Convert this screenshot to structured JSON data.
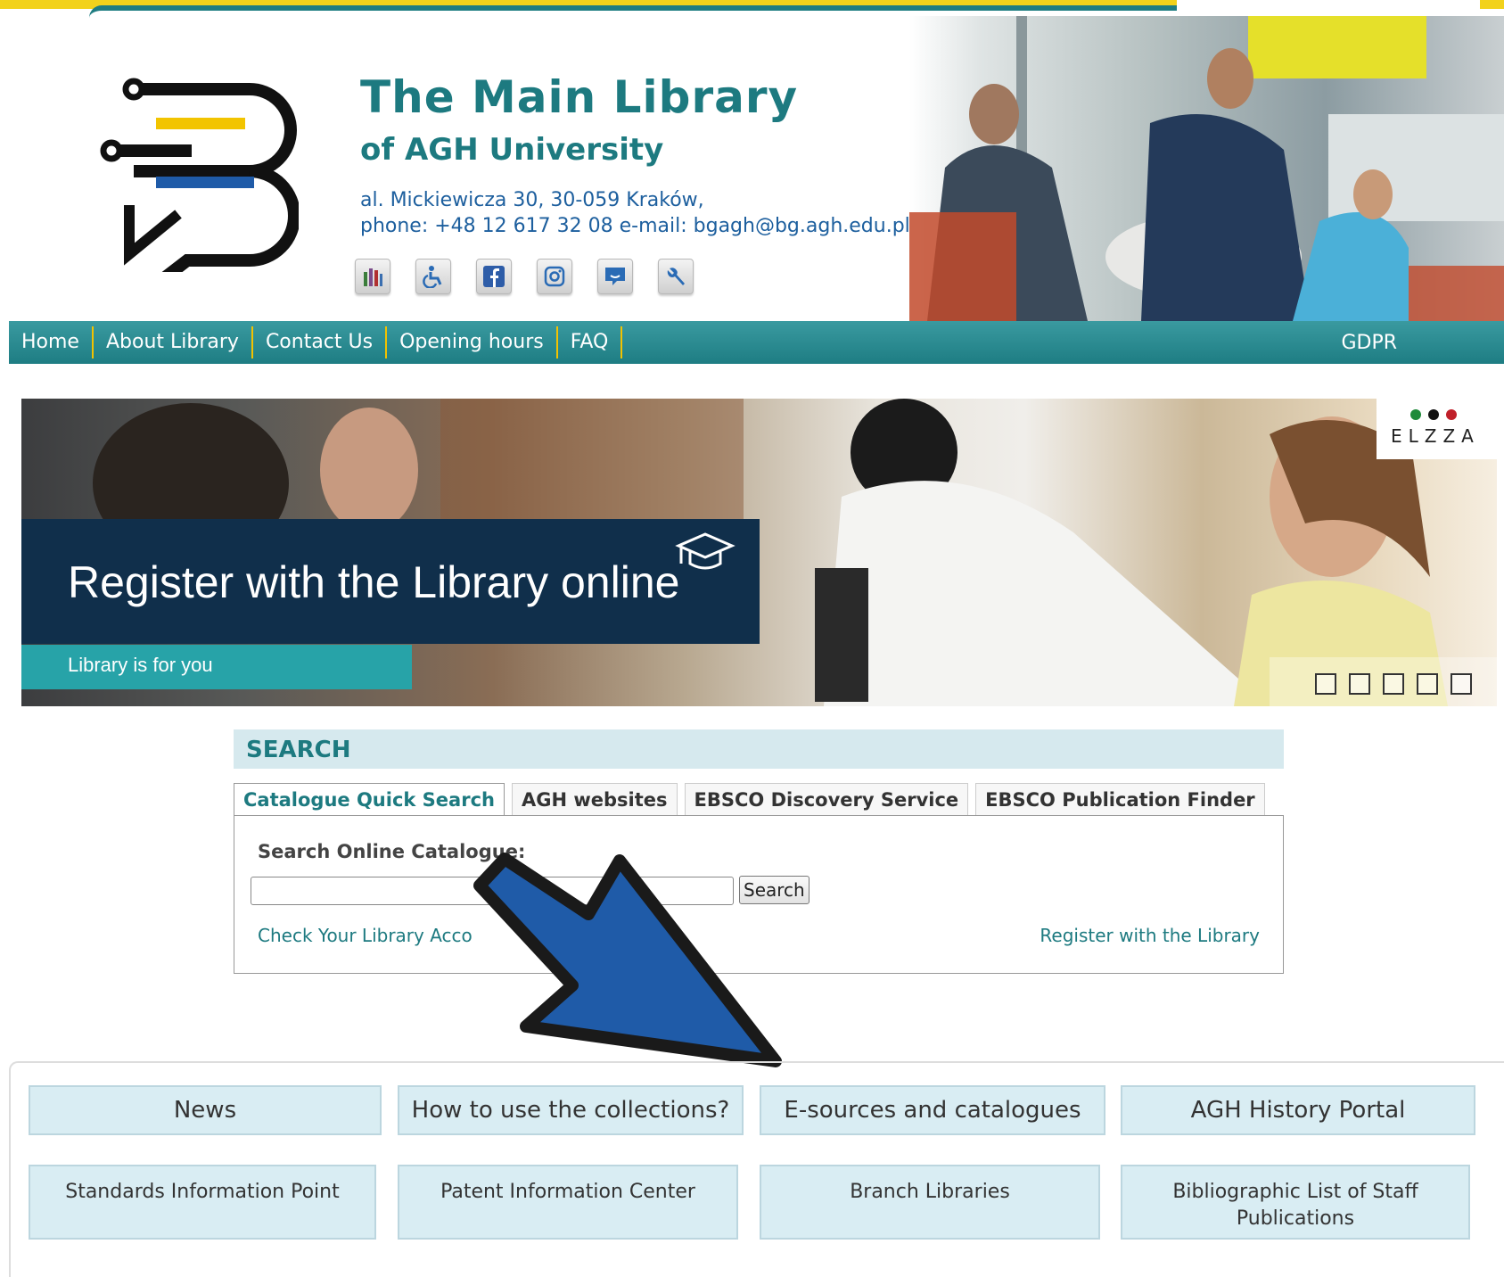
{
  "header": {
    "title": "The Main Library",
    "subtitle": "of AGH University",
    "address": "al. Mickiewicza 30, 30-059 Kraków,",
    "contact": "phone: +48 12 617 32 08 e-mail: bgagh@bg.agh.edu.pl",
    "icons": [
      "library-stats-icon",
      "accessibility-icon",
      "facebook-icon",
      "instagram-icon",
      "chat-icon",
      "tools-icon"
    ]
  },
  "nav": {
    "items": [
      "Home",
      "About Library",
      "Contact Us",
      "Opening hours",
      "FAQ"
    ],
    "gdpr": "GDPR"
  },
  "banner": {
    "title": "Register with the Library online",
    "subtitle": "Library is for you",
    "brand": "ELZZA",
    "slide_count": 5
  },
  "search": {
    "heading": "SEARCH",
    "tabs": [
      "Catalogue Quick Search",
      "AGH websites",
      "EBSCO Discovery Service",
      "EBSCO Publication Finder"
    ],
    "active_tab": "Catalogue Quick Search",
    "label": "Search Online Catalogue:",
    "input_value": "",
    "button": "Search",
    "link_left": "Check Your Library Acco",
    "link_right": "Register with the Library"
  },
  "quick_links": {
    "row1": [
      "News",
      "How to use the collections?",
      "E-sources and catalogues",
      "AGH History Portal"
    ],
    "row2": [
      "Standards Information Point",
      "Patent Information Center",
      "Branch Libraries",
      "Bibliographic List of Staff Publications"
    ]
  },
  "colors": {
    "teal": "#1d7a80",
    "yellow": "#f2d21b",
    "navy": "#102f4b",
    "arrow_blue": "#1f5ba8"
  }
}
